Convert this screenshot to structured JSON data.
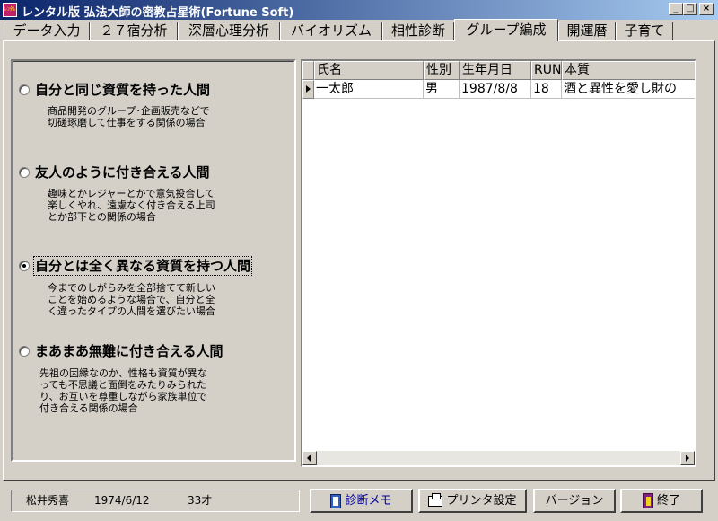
{
  "window": {
    "icon_text": "ﾚﾝﾀﾙ",
    "title": "レンタル版 弘法大師の密教占星術(Fortune Soft)",
    "min_label": "_",
    "max_label": "□",
    "close_label": "×"
  },
  "tabs": [
    {
      "label": "データ入力"
    },
    {
      "label": "２７宿分析"
    },
    {
      "label": "深層心理分析"
    },
    {
      "label": "バイオリズム"
    },
    {
      "label": "相性診断"
    },
    {
      "label": "グループ編成",
      "active": true
    },
    {
      "label": "開運暦"
    },
    {
      "label": "子育て"
    }
  ],
  "options": [
    {
      "label": "自分と同じ資質を持った人間",
      "selected": false,
      "desc": [
        "商品開発のグループ･企画販売などで",
        "切磋琢磨して仕事をする関係の場合"
      ]
    },
    {
      "label": "友人のように付き合える人間",
      "selected": false,
      "desc": [
        "趣味とかレジャーとかで意気投合して",
        "楽しくやれ、遠慮なく付き合える上司",
        "とか部下との関係の場合"
      ]
    },
    {
      "label": "自分とは全く異なる資質を持つ人間",
      "selected": true,
      "desc": [
        "今までのしがらみを全部捨てて新しい",
        "ことを始めるような場合で、自分と全",
        "く違ったタイプの人間を選びたい場合"
      ]
    },
    {
      "label": "まあまあ無難に付き合える人間",
      "selected": false,
      "desc": [
        "先祖の因縁なのか、性格も資質が異な",
        "っても不思議と面倒をみたりみられた",
        "り、お互いを尊重しながら家族単位で",
        "付き合える関係の場合"
      ]
    }
  ],
  "grid": {
    "columns": [
      "氏名",
      "性別",
      "生年月日",
      "RUN",
      "本質"
    ],
    "rows": [
      [
        "一太郎",
        "男",
        "1987/8/8",
        "18",
        "酒と異性を愛し財の"
      ]
    ]
  },
  "status": {
    "name": "松井秀喜",
    "birthdate": "1974/6/12",
    "age": "33才"
  },
  "buttons": {
    "memo": "診断メモ",
    "printer": "プリンタ設定",
    "version": "バージョン",
    "exit": "終了"
  },
  "colors": {
    "title_start": "#0a246a",
    "title_end": "#a6caf0",
    "face": "#d4d0c8",
    "memo_text": "#0000a0"
  }
}
